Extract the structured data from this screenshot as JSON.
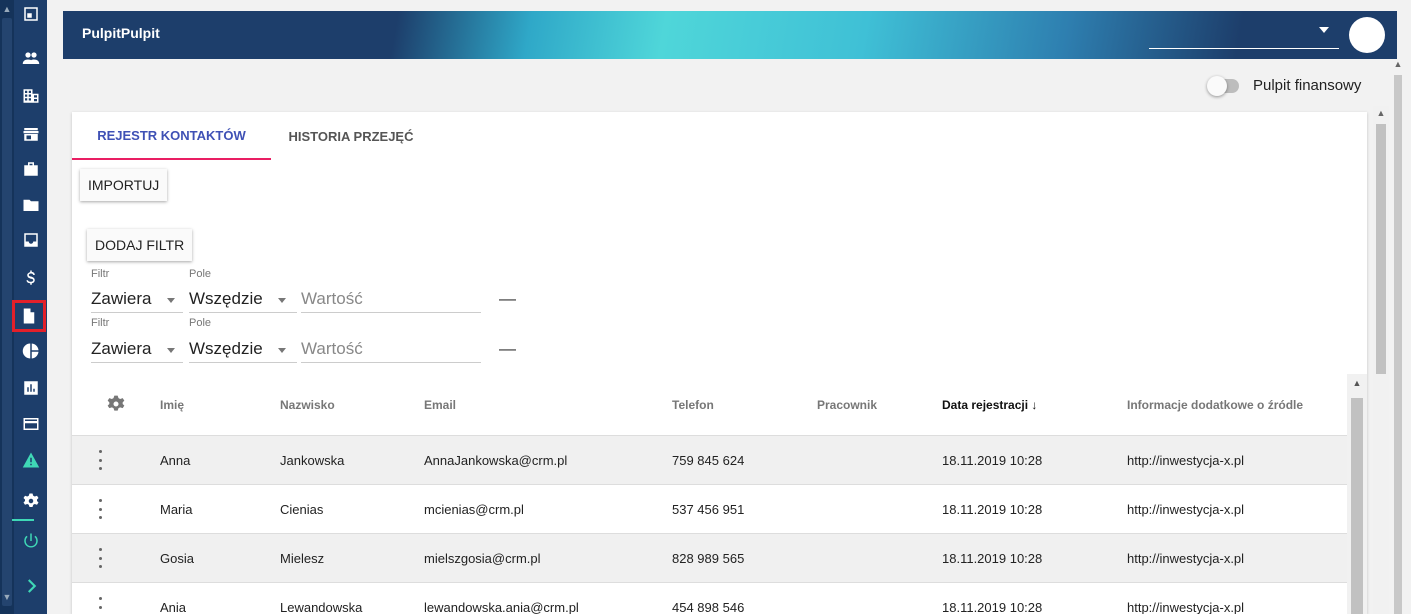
{
  "header": {
    "app_title": "PulpitPulpit"
  },
  "sidebar": {
    "items": [
      {
        "icon": "dashboard-icon"
      },
      {
        "icon": "people-icon"
      },
      {
        "icon": "building-icon"
      },
      {
        "icon": "store-icon"
      },
      {
        "icon": "briefcase-icon"
      },
      {
        "icon": "folder-icon"
      },
      {
        "icon": "inbox-icon"
      },
      {
        "icon": "dollar-icon"
      },
      {
        "icon": "document-icon",
        "active": true
      },
      {
        "icon": "pie-chart-icon"
      },
      {
        "icon": "bar-chart-icon"
      },
      {
        "icon": "card-icon"
      },
      {
        "icon": "warning-icon"
      },
      {
        "icon": "settings-icon"
      },
      {
        "icon": "power-icon"
      },
      {
        "icon": "chevron-right-icon"
      }
    ],
    "accent_color": "#3fd8b6",
    "active_outline_color": "#e3202a"
  },
  "topbar": {
    "toggle_label": "Pulpit finansowy"
  },
  "tabs": [
    {
      "label": "REJESTR KONTAKTÓW",
      "active": true
    },
    {
      "label": "HISTORIA PRZEJĘĆ",
      "active": false
    }
  ],
  "buttons": {
    "import_label": "IMPORTUJ",
    "add_filter_label": "DODAJ FILTR"
  },
  "filters": [
    {
      "filter_label": "Filtr",
      "filter_value": "Zawiera",
      "field_label": "Pole",
      "field_value": "Wszędzie",
      "value_placeholder": "Wartość",
      "remove": "—"
    },
    {
      "filter_label": "Filtr",
      "filter_value": "Zawiera",
      "field_label": "Pole",
      "field_value": "Wszędzie",
      "value_placeholder": "Wartość",
      "remove": "—"
    }
  ],
  "table": {
    "columns": [
      "Imię",
      "Nazwisko",
      "Email",
      "Telefon",
      "Pracownik",
      "Data rejestracji",
      "Informacje dodatkowe o źródle"
    ],
    "sort_indicator": "↓",
    "rows": [
      {
        "first": "Anna",
        "last": "Jankowska",
        "email": "AnnaJankowska@crm.pl",
        "phone": "759 845 624",
        "employee": "",
        "date": "18.11.2019 10:28",
        "source": "http://inwestycja-x.pl"
      },
      {
        "first": "Maria",
        "last": "Cienias",
        "email": "mcienias@crm.pl",
        "phone": "537 456 951",
        "employee": "",
        "date": "18.11.2019 10:28",
        "source": "http://inwestycja-x.pl"
      },
      {
        "first": "Gosia",
        "last": "Mielesz",
        "email": "mielszgosia@crm.pl",
        "phone": "828 989 565",
        "employee": "",
        "date": "18.11.2019 10:28",
        "source": "http://inwestycja-x.pl"
      },
      {
        "first": "Ania",
        "last": "Lewandowska",
        "email": "lewandowska.ania@crm.pl",
        "phone": "454 898 546",
        "employee": "",
        "date": "18.11.2019 10:28",
        "source": "http://inwestycja-x.pl"
      }
    ]
  },
  "colors": {
    "tab_active": "#3f51b5",
    "tab_underline": "#e91e63",
    "sidebar_bg": "#1d3e6b"
  }
}
